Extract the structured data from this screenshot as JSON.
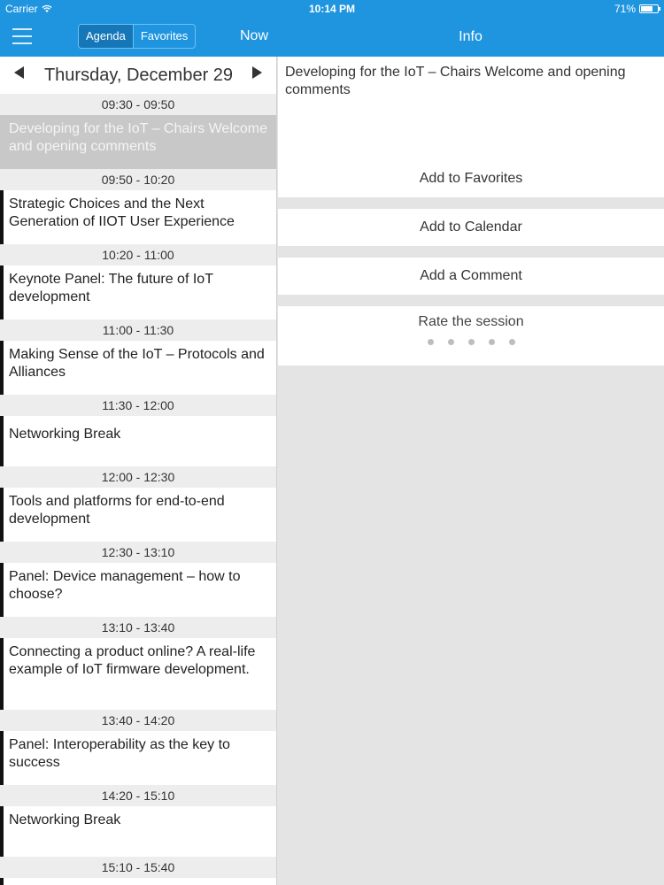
{
  "status_bar": {
    "carrier": "Carrier",
    "time": "10:14 PM",
    "battery": "71%",
    "battery_level": 0.71
  },
  "nav": {
    "menu_icon": "hamburger-menu-icon",
    "tabs": [
      {
        "label": "Agenda",
        "selected": true
      },
      {
        "label": "Favorites",
        "selected": false
      }
    ],
    "now_label": "Now",
    "info_title": "Info"
  },
  "agenda": {
    "date": "Thursday, December 29",
    "prev_icon": "triangle-left-icon",
    "next_icon": "triangle-right-icon",
    "slots": [
      {
        "time": "09:30 - 09:50",
        "title": "Developing for the IoT – Chairs Welcome and opening comments",
        "selected": true
      },
      {
        "time": "09:50 - 10:20",
        "title": "Strategic Choices and the Next Generation of IIOT User Experience",
        "selected": false
      },
      {
        "time": "10:20 - 11:00",
        "title": "Keynote Panel: The future of IoT development",
        "selected": false
      },
      {
        "time": "11:00 - 11:30",
        "title": "Making Sense of the IoT – Protocols and Alliances",
        "selected": false
      },
      {
        "time": "11:30 - 12:00",
        "title": "Networking Break",
        "selected": false
      },
      {
        "time": "12:00 - 12:30",
        "title": "Tools and platforms for end-to-end development",
        "selected": false
      },
      {
        "time": "12:30 - 13:10",
        "title": "Panel: Device management – how to choose?",
        "selected": false
      },
      {
        "time": "13:10 - 13:40",
        "title": "Connecting a product online? A real-life example of IoT firmware development.",
        "selected": false
      },
      {
        "time": "13:40 - 14:20",
        "title": "Panel: Interoperability as the key to success",
        "selected": false
      },
      {
        "time": "14:20 - 15:10",
        "title": "Networking Break",
        "selected": false
      },
      {
        "time": "15:10 - 15:40",
        "title": "",
        "selected": false
      }
    ]
  },
  "info": {
    "session_title": "Developing for the IoT – Chairs Welcome and opening comments",
    "add_favorites": "Add to Favorites",
    "add_calendar": "Add to Calendar",
    "add_comment": "Add a Comment",
    "rate_label": "Rate the session",
    "rating": 0,
    "rating_max": 5
  }
}
